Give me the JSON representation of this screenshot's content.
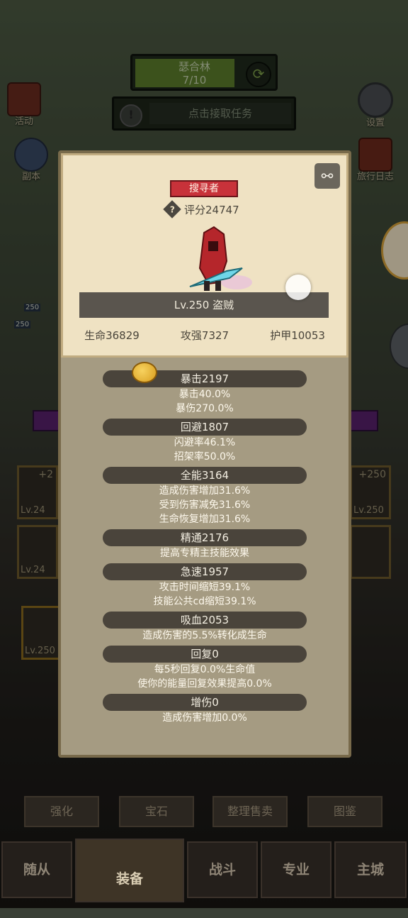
{
  "stage": {
    "title": "瑟合林",
    "count": "7/10"
  },
  "quest": {
    "label": "点击接取任务"
  },
  "side_buttons": {
    "activity": "活动",
    "settings": "设置",
    "dungeon": "副本",
    "journal": "旅行日志"
  },
  "left_heroes": {
    "lv1": "250",
    "lv2": "250"
  },
  "equip_slots": {
    "slot1_level": "Lv.24",
    "slot1_plus": "+2",
    "slot2_level": "Lv.24",
    "slot3_level": "Lv.250",
    "slot4_level": "Lv.250",
    "slot4_plus": "+250"
  },
  "panel": {
    "class_badge": "搜寻者",
    "score": "评分24747",
    "level_line": "Lv.250 盗贼",
    "base_stats": [
      "生命36829",
      "攻强7327",
      "护甲10053"
    ],
    "stats": [
      {
        "head": "暴击2197",
        "lines": [
          "暴击40.0%",
          "暴伤270.0%"
        ]
      },
      {
        "head": "回避1807",
        "lines": [
          "闪避率46.1%",
          "招架率50.0%"
        ]
      },
      {
        "head": "全能3164",
        "lines": [
          "造成伤害增加31.6%",
          "受到伤害减免31.6%",
          "生命恢复增加31.6%"
        ]
      },
      {
        "head": "精通2176",
        "lines": [
          "提高专精主技能效果"
        ]
      },
      {
        "head": "急速1957",
        "lines": [
          "攻击时间缩短39.1%",
          "技能公共cd缩短39.1%"
        ]
      },
      {
        "head": "吸血2053",
        "lines": [
          "造成伤害的5.5%转化成生命"
        ]
      },
      {
        "head": "回复0",
        "lines": [
          "每5秒回复0.0%生命值",
          "使你的能量回复效果提高0.0%"
        ]
      },
      {
        "head": "增伤0",
        "lines": [
          "造成伤害增加0.0%"
        ]
      }
    ]
  },
  "sub_buttons": [
    "强化",
    "宝石",
    "整理售卖",
    "图鉴"
  ],
  "nav": [
    "随从",
    "装备",
    "战斗",
    "专业",
    "主城"
  ]
}
